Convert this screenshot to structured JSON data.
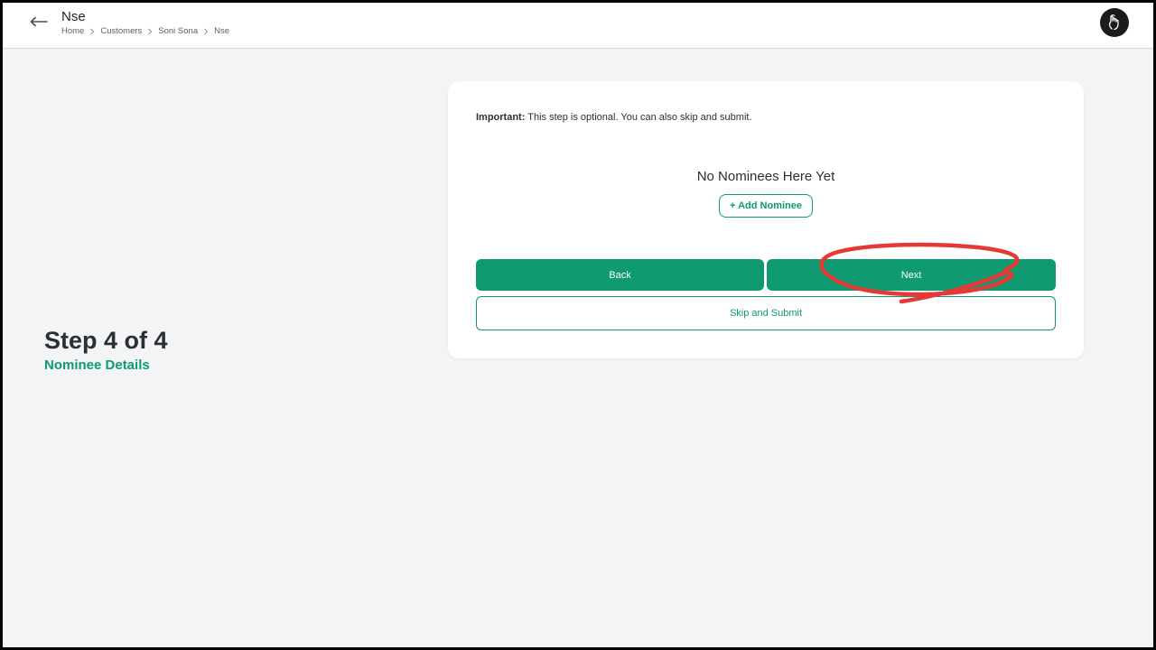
{
  "header": {
    "title": "Nse",
    "breadcrumb": [
      "Home",
      "Customers",
      "Soni Sona",
      "Nse"
    ]
  },
  "step": {
    "title": "Step 4 of 4",
    "subtitle": "Nominee Details"
  },
  "card": {
    "notice_label": "Important:",
    "notice_text": " This step is optional. You can also skip and submit.",
    "empty_message": "No Nominees Here Yet",
    "add_nominee_label": "+ Add Nominee",
    "back_label": "Back",
    "next_label": "Next",
    "skip_label": "Skip and Submit"
  },
  "colors": {
    "accent": "#0f9a72",
    "annotation": "#e53935",
    "background": "#f3f4f6"
  },
  "icons": {
    "back": "arrow-left-icon",
    "breadcrumb_separator": "chevron-right-icon",
    "avatar": "hand-logo-icon"
  }
}
